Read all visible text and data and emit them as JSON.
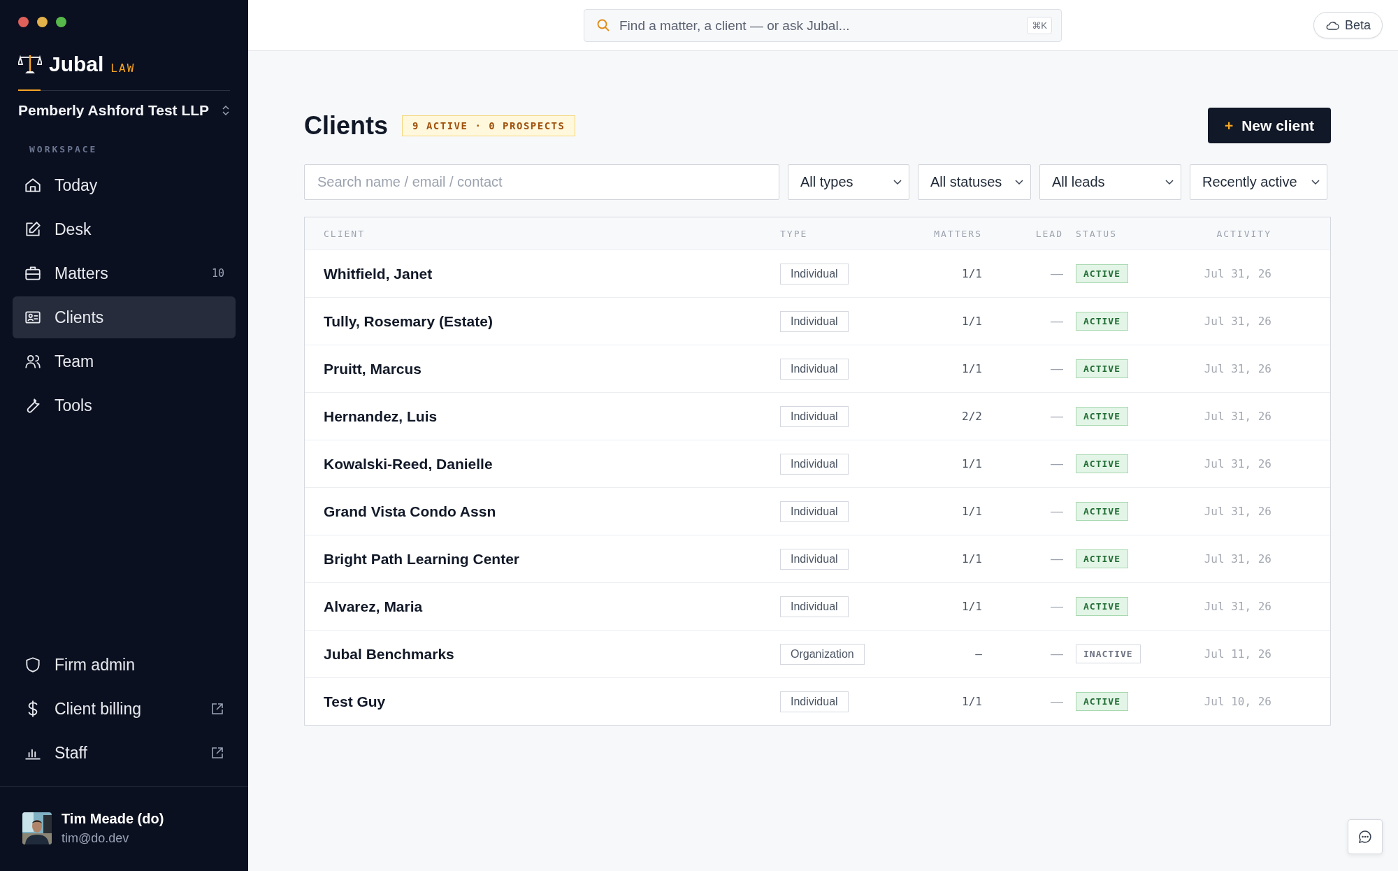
{
  "sidebar": {
    "brand": {
      "name": "Jubal",
      "tag": "LAW"
    },
    "firm": "Pemberly Ashford Test LLP",
    "section": "WORKSPACE",
    "nav": [
      {
        "label": "Today",
        "selected": false
      },
      {
        "label": "Desk",
        "selected": false
      },
      {
        "label": "Matters",
        "badge": "10",
        "selected": false
      },
      {
        "label": "Clients",
        "selected": true
      },
      {
        "label": "Team",
        "selected": false
      },
      {
        "label": "Tools",
        "selected": false
      }
    ],
    "footer_nav": [
      {
        "label": "Firm admin",
        "external": false
      },
      {
        "label": "Client billing",
        "external": true
      },
      {
        "label": "Staff",
        "external": true
      }
    ],
    "user": {
      "name": "Tim Meade (do)",
      "email": "tim@do.dev"
    }
  },
  "topbar": {
    "search": {
      "placeholder": "Find a matter, a client — or ask Jubal...",
      "shortcut": "⌘K"
    },
    "beta_button": "Beta"
  },
  "page": {
    "title": "Clients",
    "summary": "9 ACTIVE · 0 PROSPECTS",
    "new_button": {
      "plus": "+",
      "label": "New client"
    },
    "filters": {
      "search": {
        "placeholder": "Search name / email / contact"
      },
      "selects": [
        {
          "value": "All types"
        },
        {
          "value": "All statuses"
        },
        {
          "value": "All leads"
        },
        {
          "value": "Recently active"
        }
      ]
    },
    "table": {
      "columns": [
        "CLIENT",
        "TYPE",
        "MATTERS",
        "LEAD",
        "STATUS",
        "ACTIVITY"
      ],
      "rows": [
        {
          "client": "Whitfield, Janet",
          "type": "Individual",
          "matters": "1/1",
          "lead": "—",
          "status": {
            "label": "ACTIVE",
            "kind": "active"
          },
          "activity": "Jul 31, 26"
        },
        {
          "client": "Tully, Rosemary (Estate)",
          "type": "Individual",
          "matters": "1/1",
          "lead": "—",
          "status": {
            "label": "ACTIVE",
            "kind": "active"
          },
          "activity": "Jul 31, 26"
        },
        {
          "client": "Pruitt, Marcus",
          "type": "Individual",
          "matters": "1/1",
          "lead": "—",
          "status": {
            "label": "ACTIVE",
            "kind": "active"
          },
          "activity": "Jul 31, 26"
        },
        {
          "client": "Hernandez, Luis",
          "type": "Individual",
          "matters": "2/2",
          "lead": "—",
          "status": {
            "label": "ACTIVE",
            "kind": "active"
          },
          "activity": "Jul 31, 26"
        },
        {
          "client": "Kowalski-Reed, Danielle",
          "type": "Individual",
          "matters": "1/1",
          "lead": "—",
          "status": {
            "label": "ACTIVE",
            "kind": "active"
          },
          "activity": "Jul 31, 26"
        },
        {
          "client": "Grand Vista Condo Assn",
          "type": "Individual",
          "matters": "1/1",
          "lead": "—",
          "status": {
            "label": "ACTIVE",
            "kind": "active"
          },
          "activity": "Jul 31, 26"
        },
        {
          "client": "Bright Path Learning Center",
          "type": "Individual",
          "matters": "1/1",
          "lead": "—",
          "status": {
            "label": "ACTIVE",
            "kind": "active"
          },
          "activity": "Jul 31, 26"
        },
        {
          "client": "Alvarez, Maria",
          "type": "Individual",
          "matters": "1/1",
          "lead": "—",
          "status": {
            "label": "ACTIVE",
            "kind": "active"
          },
          "activity": "Jul 31, 26"
        },
        {
          "client": "Jubal Benchmarks",
          "type": "Organization",
          "matters": "–",
          "lead": "—",
          "status": {
            "label": "INACTIVE",
            "kind": "inactive"
          },
          "activity": "Jul 11, 26"
        },
        {
          "client": "Test Guy",
          "type": "Individual",
          "matters": "1/1",
          "lead": "—",
          "status": {
            "label": "ACTIVE",
            "kind": "active"
          },
          "activity": "Jul 10, 26"
        }
      ]
    }
  }
}
